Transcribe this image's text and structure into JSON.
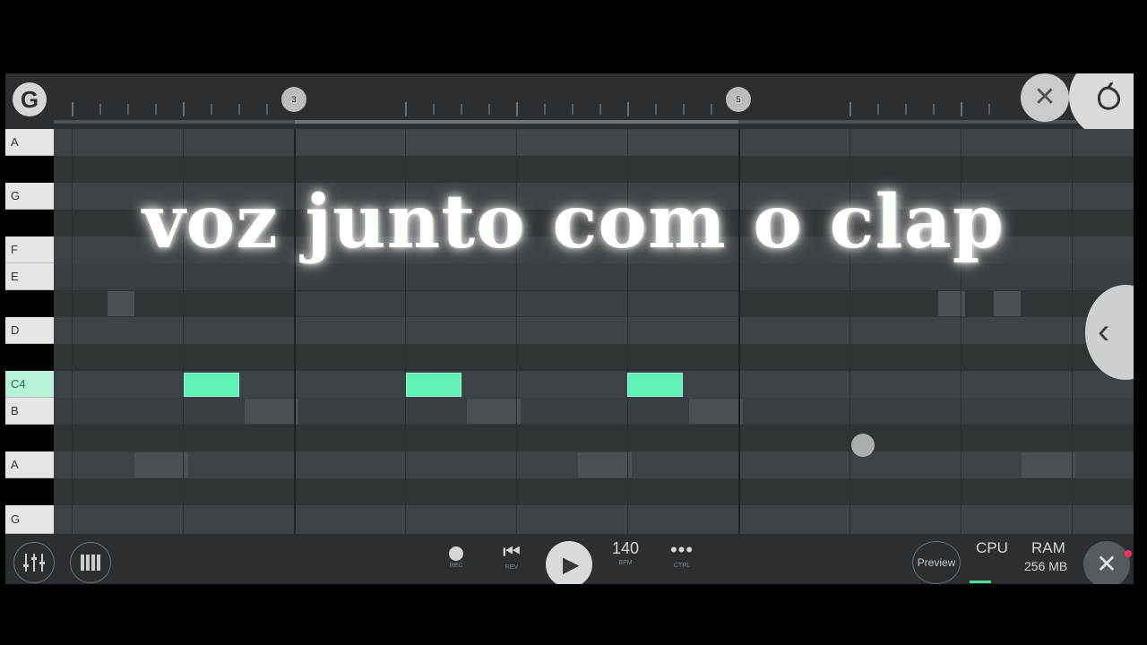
{
  "timeline": {
    "markers": [
      "3",
      "5"
    ]
  },
  "top_buttons": {
    "logo_icon": "fl-logo-icon",
    "close_icon": "close-icon",
    "fruit_icon": "fl-fruit-icon"
  },
  "keyboard": {
    "labels": [
      "A",
      "G",
      "F",
      "E",
      "D",
      "C4",
      "B",
      "A",
      "G"
    ]
  },
  "overlay": {
    "caption": "voz junto com o clap"
  },
  "transport": {
    "rec_label": "REC",
    "rev_label": "REV",
    "bpm_value": "140",
    "bpm_label": "BPM",
    "ctrl_label": "CTRL"
  },
  "status": {
    "preview_label": "Preview",
    "cpu_label": "CPU",
    "ram_label": "RAM",
    "ram_value": "256 MB"
  },
  "colors": {
    "note": "#5ff0b3",
    "background": "#353a3e",
    "highlight_key": "#b7f3d8"
  }
}
